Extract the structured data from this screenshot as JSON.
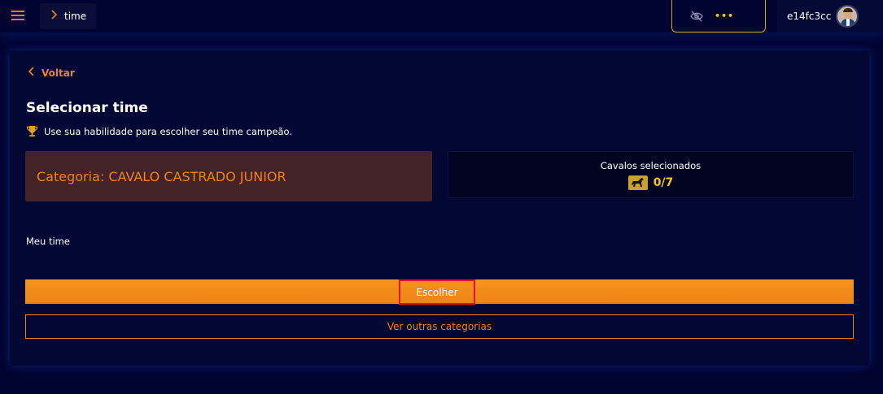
{
  "header": {
    "breadcrumb": "time",
    "balance_hidden": "•••",
    "username": "e14fc3cc"
  },
  "page": {
    "back_label": "Voltar",
    "title": "Selecionar time",
    "subtitle": "Use sua habilidade para escolher seu time campeão.",
    "category": "Categoria: CAVALO CASTRADO JUNIOR",
    "selected_label": "Cavalos selecionados",
    "selected_count": "0/7",
    "team_label": "Meu time",
    "choose_button": "Escolher",
    "other_categories_button": "Ver outras categorias"
  },
  "colors": {
    "background": "#010431",
    "accent": "#f0821e",
    "gold": "#f5c518",
    "category_bg": "#432327"
  },
  "icons": [
    "menu-icon",
    "chevron-right-icon",
    "eye-off-icon",
    "avatar",
    "chevron-left-icon",
    "trophy-icon",
    "horse-icon"
  ]
}
